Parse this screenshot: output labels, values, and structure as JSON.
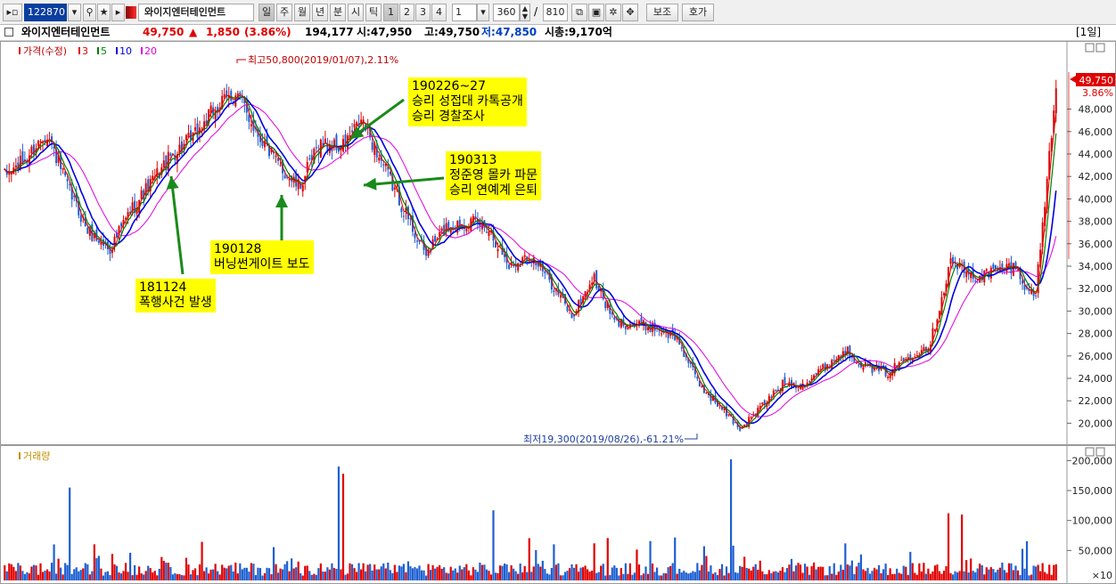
{
  "toolbar": {
    "code": "122870",
    "name": "와이지엔터테인먼트",
    "period_tabs": [
      "일",
      "주",
      "월",
      "년",
      "분",
      "시",
      "틱"
    ],
    "active_tab": "일",
    "multiplier_buttons": [
      "1",
      "2",
      "3",
      "4"
    ],
    "multiplier_value": "1",
    "count": "360",
    "separator": "/",
    "total": "810",
    "bojo_label": "보조",
    "hoga_label": "호가"
  },
  "infobar": {
    "name": "와이지엔터테인먼트",
    "price": "49,750",
    "change_arrow": "▲",
    "change": "1,850",
    "change_pct": "(3.86%)",
    "volume": "194,177",
    "open": "시:47,950",
    "high": "고:49,750",
    "low": "저:47,850",
    "mcap": "시총:9,170억",
    "period_label": "[1일]"
  },
  "price_pane": {
    "legend_title": "가격(수정)",
    "legend_ma": [
      {
        "label": "3",
        "color": "#e00000"
      },
      {
        "label": "5",
        "color": "#008000"
      },
      {
        "label": "10",
        "color": "#0000e0"
      },
      {
        "label": "20",
        "color": "#e000e0"
      }
    ],
    "high_marker": "최고50,800(2019/01/07),2.11%",
    "low_marker": "최저19,300(2019/08/26),-61.21%",
    "last_price": "49,750",
    "last_pct": "3.86%"
  },
  "annotations": [
    {
      "lines": [
        "181124",
        "폭행사건 발생"
      ]
    },
    {
      "lines": [
        "190128",
        "버닝썬게이트 보도"
      ]
    },
    {
      "lines": [
        "190226~27",
        "승리 성접대 카톡공개",
        "승리 경찰조사"
      ]
    },
    {
      "lines": [
        "190313",
        "정준영 몰카 파문",
        "승리 연예계 은퇴"
      ]
    }
  ],
  "volume_pane": {
    "legend_title": "거래량",
    "unit_label": "×10"
  },
  "colors": {
    "up": "#e00000",
    "down": "#1e5fd0",
    "ma3": "#e00000",
    "ma5": "#008000",
    "ma10": "#0000e0",
    "ma20": "#e000e0"
  },
  "chart_data": {
    "type": "candlestick",
    "price_axis": {
      "ylim": [
        19000,
        49000
      ],
      "ticks": [
        20000,
        22000,
        24000,
        26000,
        28000,
        30000,
        32000,
        34000,
        36000,
        38000,
        40000,
        42000,
        44000,
        46000,
        48000
      ]
    },
    "volume_axis": {
      "ylim": [
        0,
        205000
      ],
      "ticks": [
        50000,
        100000,
        150000,
        200000
      ]
    },
    "price_path": [
      42000,
      43500,
      46000,
      41000,
      37000,
      35500,
      39000,
      41500,
      44000,
      45500,
      48000,
      49500,
      46000,
      43000,
      41000,
      45000,
      44500,
      47000,
      43000,
      39000,
      35000,
      37500,
      38000,
      37500,
      34000,
      35000,
      32500,
      29500,
      33000,
      29000,
      28800,
      28500,
      27500,
      23500,
      21500,
      19500,
      21500,
      23500,
      23500,
      25000,
      26500,
      25000,
      24500,
      26000,
      27000,
      34500,
      33000,
      33500,
      34000,
      31000,
      49750
    ],
    "volume_spikes": [
      {
        "index": 78,
        "volume": 155000
      },
      {
        "index": 378,
        "volume": 190000
      },
      {
        "index": 383,
        "volume": 178000
      },
      {
        "index": 552,
        "volume": 117000
      },
      {
        "index": 818,
        "volume": 202000
      },
      {
        "index": 1063,
        "volume": 112000
      },
      {
        "index": 1078,
        "volume": 110000
      }
    ]
  }
}
